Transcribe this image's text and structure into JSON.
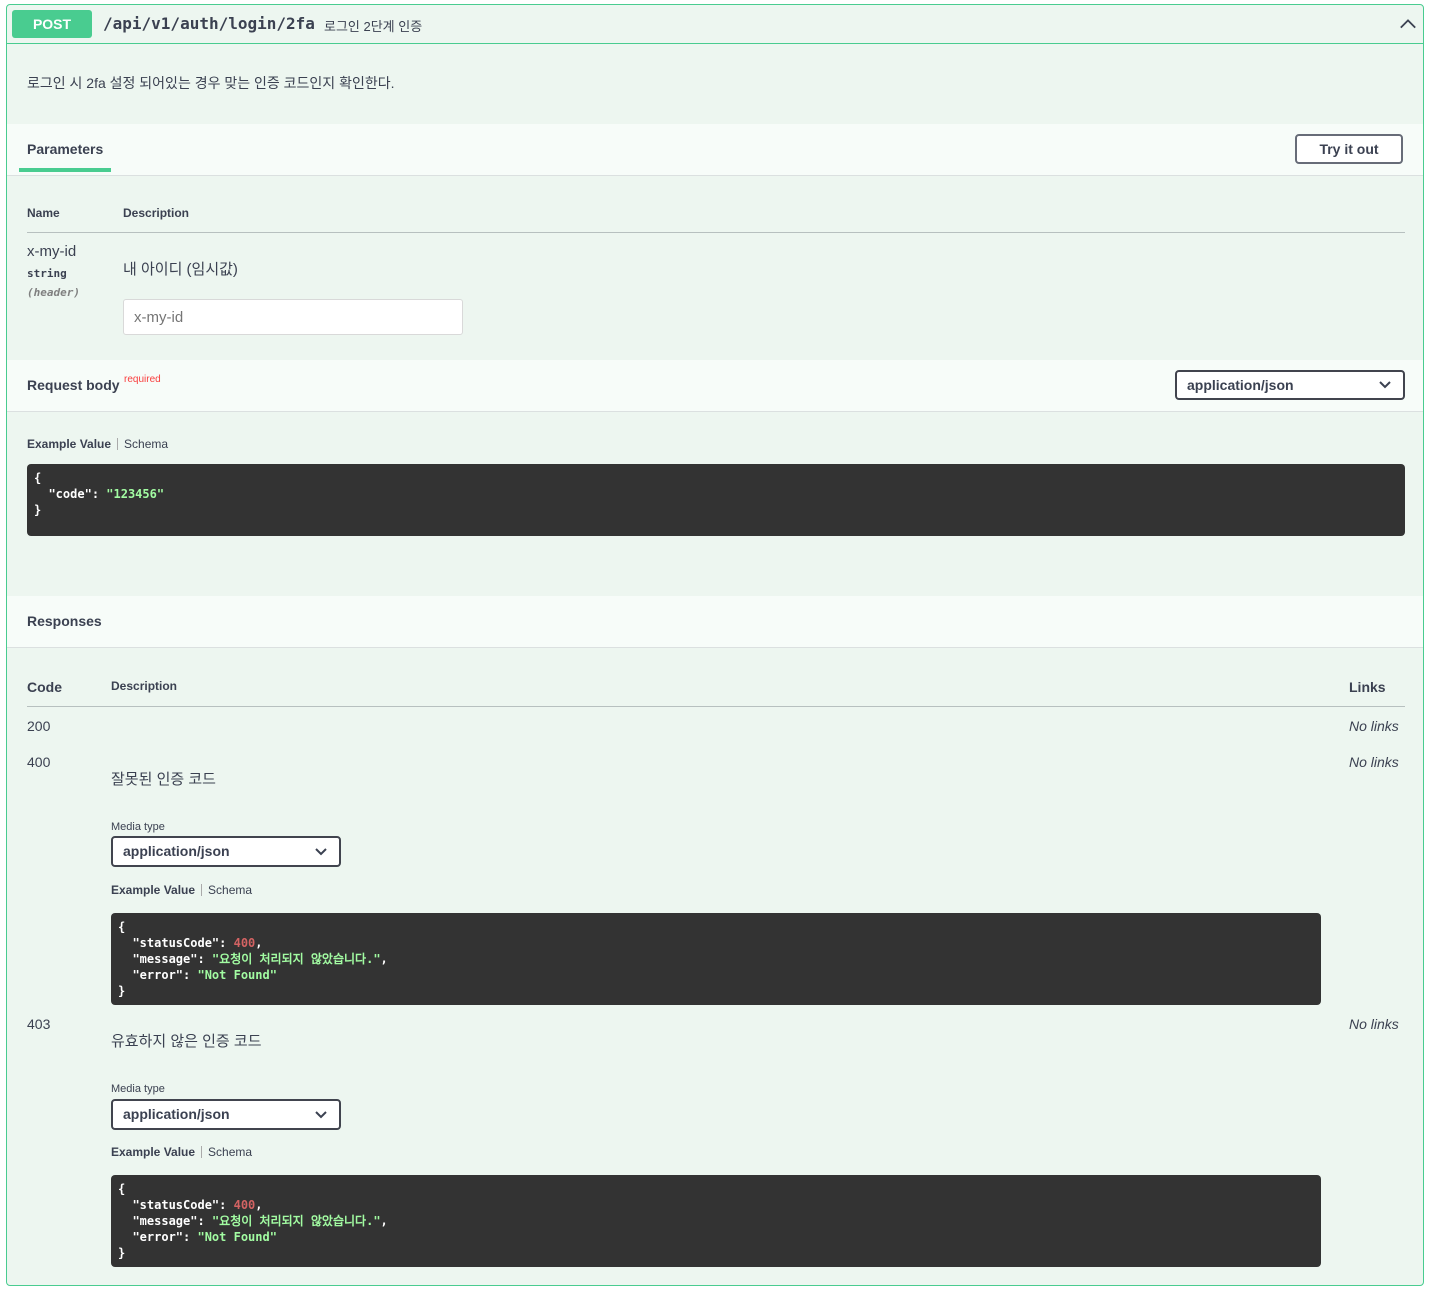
{
  "summary": {
    "method": "POST",
    "path": "/api/v1/auth/login/2fa",
    "description": "로그인 2단계 인증"
  },
  "operation_description": "로그인 시 2fa 설정 되어있는 경우 맞는 인증 코드인지 확인한다.",
  "parameters": {
    "tab_label": "Parameters",
    "try_it_out": "Try it out",
    "col_name": "Name",
    "col_description": "Description",
    "items": [
      {
        "name": "x-my-id",
        "type": "string",
        "in": "(header)",
        "description": "내 아이디 (임시값)",
        "placeholder": "x-my-id"
      }
    ]
  },
  "request_body": {
    "title": "Request body",
    "required_label": "required",
    "content_type": "application/json",
    "example_tab": "Example Value",
    "schema_tab": "Schema",
    "example": {
      "open": "{",
      "key_code": "\"code\"",
      "val_code": "\"123456\"",
      "close": "}"
    }
  },
  "responses": {
    "title": "Responses",
    "col_code": "Code",
    "col_description": "Description",
    "col_links": "Links",
    "media_type_label": "Media type",
    "example_tab": "Example Value",
    "schema_tab": "Schema",
    "items": [
      {
        "code": "200",
        "description": "",
        "links": "No links"
      },
      {
        "code": "400",
        "description": "잘못된 인증 코드",
        "links": "No links",
        "media_type": "application/json",
        "example": {
          "k_status": "\"statusCode\"",
          "v_status": "400",
          "k_message": "\"message\"",
          "v_message": "\"요청이 처리되지 않았습니다.\"",
          "k_error": "\"error\"",
          "v_error": "\"Not Found\""
        }
      },
      {
        "code": "403",
        "description": "유효하지 않은 인증 코드",
        "links": "No links",
        "media_type": "application/json",
        "example": {
          "k_status": "\"statusCode\"",
          "v_status": "400",
          "k_message": "\"message\"",
          "v_message": "\"요청이 처리되지 않았습니다.\"",
          "k_error": "\"error\"",
          "v_error": "\"Not Found\""
        }
      }
    ]
  },
  "colors": {
    "post_green": "#49cc90",
    "opblock_bg": "#edf6f0",
    "code_bg": "#333333",
    "string_green": "#a2fca2",
    "number_red": "#d36363",
    "required_red": "#f93e3e"
  },
  "icons": [
    "chevron-up-icon",
    "chevron-down-icon"
  ]
}
